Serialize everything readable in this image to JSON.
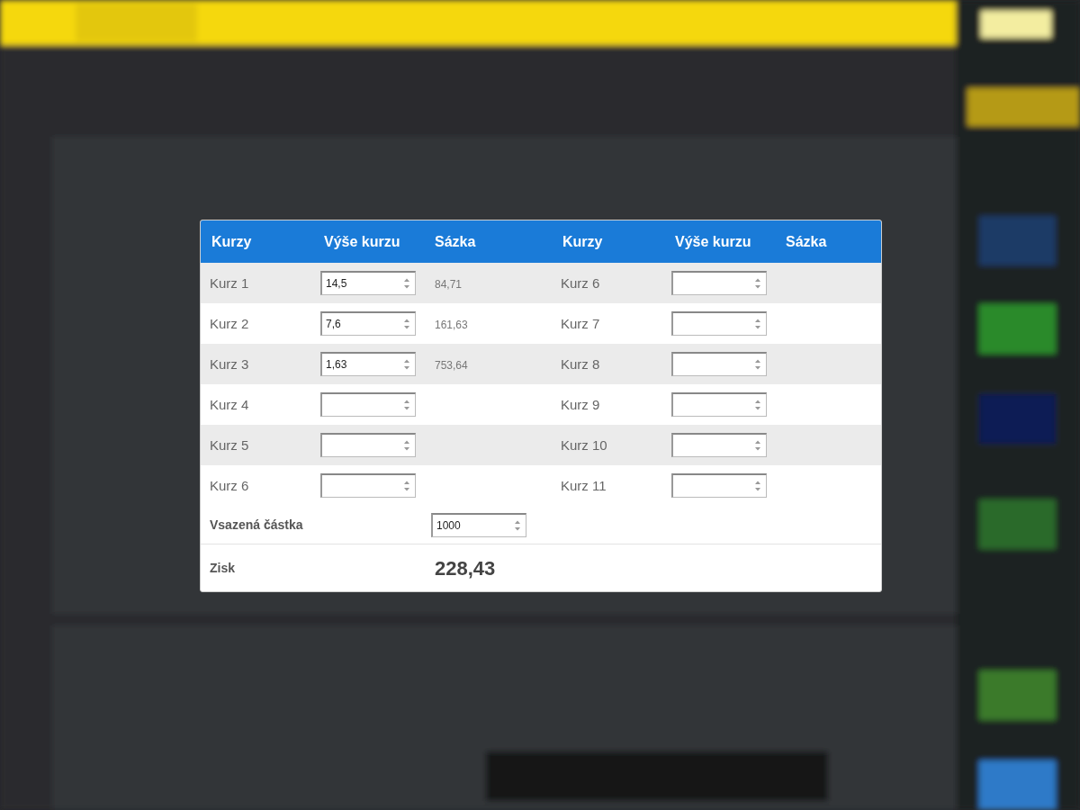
{
  "calculator": {
    "columns": [
      "Kurzy",
      "Výše kurzu",
      "Sázka",
      "Kurzy",
      "Výše kurzu",
      "Sázka"
    ],
    "rows": [
      {
        "left": {
          "label": "Kurz 1",
          "odds": "14,5",
          "stake": "84,71"
        },
        "right": {
          "label": "Kurz 6"
        }
      },
      {
        "left": {
          "label": "Kurz 2",
          "odds": "7,6",
          "stake": "161,63"
        },
        "right": {
          "label": "Kurz 7"
        }
      },
      {
        "left": {
          "label": "Kurz 3",
          "odds": "1,63",
          "stake": "753,64"
        },
        "right": {
          "label": "Kurz 8"
        }
      },
      {
        "left": {
          "label": "Kurz 4"
        },
        "right": {
          "label": "Kurz 9"
        }
      },
      {
        "left": {
          "label": "Kurz 5"
        },
        "right": {
          "label": "Kurz 10"
        }
      },
      {
        "left": {
          "label": "Kurz 6"
        },
        "right": {
          "label": "Kurz 11"
        }
      }
    ],
    "stake_row": {
      "label": "Vsazená částka",
      "value": "1000"
    },
    "profit_row": {
      "label": "Zisk",
      "value": "228,43"
    }
  }
}
